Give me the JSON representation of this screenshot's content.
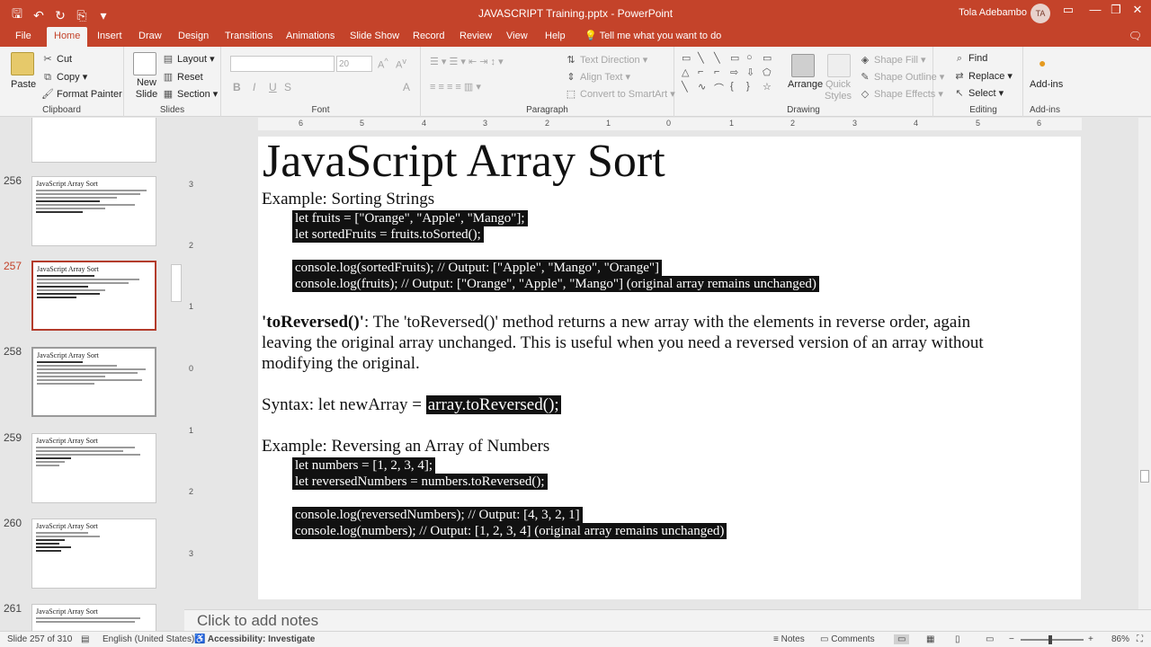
{
  "app": {
    "document_title": "JAVASCRIPT Training.pptx  -  PowerPoint",
    "user_name": "Tola Adebambo",
    "user_initials": "TA"
  },
  "qat": {
    "save": "🖫",
    "undo": "↶",
    "redo": "↻",
    "start": "⎘",
    "more": "▾"
  },
  "window": {
    "ribbon_opts": "▭",
    "minimize": "—",
    "restore": "❐",
    "close": "✕"
  },
  "tabs": [
    "File",
    "Home",
    "Insert",
    "Draw",
    "Design",
    "Transitions",
    "Animations",
    "Slide Show",
    "Record",
    "Review",
    "View",
    "Help"
  ],
  "tellme": "Tell me what you want to do",
  "ribbon": {
    "clipboard": {
      "paste": "Paste",
      "cut": "Cut",
      "copy": "Copy",
      "format_painter": "Format Painter",
      "label": "Clipboard"
    },
    "slides": {
      "new_slide": "New Slide",
      "layout": "Layout",
      "reset": "Reset",
      "section": "Section",
      "label": "Slides"
    },
    "font": {
      "size": "20",
      "label": "Font",
      "bold": "B",
      "italic": "I",
      "underline": "U",
      "strike": "S",
      "aa": "A"
    },
    "paragraph": {
      "text_direction": "Text Direction",
      "align_text": "Align Text",
      "smartart": "Convert to SmartArt",
      "label": "Paragraph"
    },
    "drawing": {
      "arrange": "Arrange",
      "quick_styles": "Quick Styles",
      "shape_fill": "Shape Fill",
      "shape_outline": "Shape Outline",
      "shape_effects": "Shape Effects",
      "label": "Drawing"
    },
    "editing": {
      "find": "Find",
      "replace": "Replace",
      "select": "Select",
      "label": "Editing"
    },
    "addins": {
      "addins": "Add-ins",
      "label": "Add-ins"
    }
  },
  "thumbnails": [
    {
      "num": "",
      "title": ""
    },
    {
      "num": "256",
      "title": "JavaScript Array Sort"
    },
    {
      "num": "257",
      "title": "JavaScript Array Sort"
    },
    {
      "num": "258",
      "title": "JavaScript Array Sort"
    },
    {
      "num": "259",
      "title": "JavaScript Array Sort"
    },
    {
      "num": "260",
      "title": "JavaScript Array Sort"
    },
    {
      "num": "261",
      "title": "JavaScript Array Sort"
    }
  ],
  "ruler_h": [
    "6",
    "5",
    "4",
    "3",
    "2",
    "1",
    "0",
    "1",
    "2",
    "3",
    "4",
    "5",
    "6"
  ],
  "ruler_v": [
    "3",
    "2",
    "1",
    "0",
    "1",
    "2",
    "3"
  ],
  "slide": {
    "title": "JavaScript Array Sort",
    "example1": "Example: Sorting Strings",
    "code1": [
      "let fruits = [\"Orange\", \"Apple\", \"Mango\"];",
      "let sortedFruits = fruits.toSorted();",
      "console.log(sortedFruits); // Output: [\"Apple\", \"Mango\", \"Orange\"]",
      "console.log(fruits);      // Output: [\"Orange\", \"Apple\", \"Mango\"] (original array remains unchanged)"
    ],
    "para_bold": "'toReversed()'",
    "para_1": ": The 'toReversed()' method returns a new array with the elements in reverse order, again",
    "para_2": "leaving the original array unchanged. This is useful when you need a reversed version of an array without",
    "para_3": "modifying the original.",
    "syntax_label": "Syntax: let newArray = ",
    "syntax_code": "array.toReversed();",
    "example2": "Example: Reversing an Array of Numbers",
    "code2": [
      "let numbers = [1, 2, 3, 4];",
      "let reversedNumbers = numbers.toReversed();",
      "console.log(reversedNumbers); // Output: [4, 3, 2, 1]",
      "console.log(numbers);        // Output: [1, 2, 3, 4] (original array remains unchanged)"
    ]
  },
  "notes_placeholder": "Click to add notes",
  "status": {
    "slide_of": "Slide 257 of 310",
    "language": "English (United States)",
    "accessibility": "Accessibility: Investigate",
    "notes": "Notes",
    "comments": "Comments",
    "zoom": "86%"
  }
}
